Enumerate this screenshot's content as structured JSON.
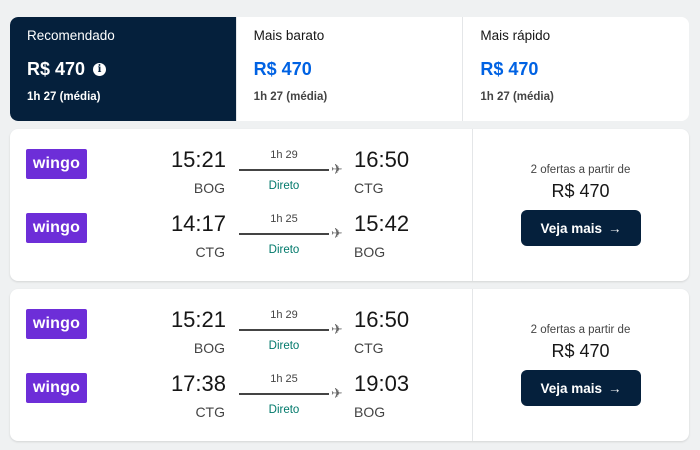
{
  "tabs": [
    {
      "label": "Recomendado",
      "price": "R$ 470",
      "duration": "1h 27 (média)",
      "info_icon": "i"
    },
    {
      "label": "Mais barato",
      "price": "R$ 470",
      "duration": "1h 27 (média)"
    },
    {
      "label": "Mais rápido",
      "price": "R$ 470",
      "duration": "1h 27 (média)"
    }
  ],
  "results": [
    {
      "legs": [
        {
          "airline": "wingo",
          "dep_time": "15:21",
          "dep_code": "BOG",
          "duration": "1h 29",
          "stops": "Direto",
          "arr_time": "16:50",
          "arr_code": "CTG"
        },
        {
          "airline": "wingo",
          "dep_time": "14:17",
          "dep_code": "CTG",
          "duration": "1h 25",
          "stops": "Direto",
          "arr_time": "15:42",
          "arr_code": "BOG"
        }
      ],
      "offers": "2 ofertas a partir de",
      "price": "R$ 470",
      "cta": "Veja mais",
      "cta_arrow": "→"
    },
    {
      "legs": [
        {
          "airline": "wingo",
          "dep_time": "15:21",
          "dep_code": "BOG",
          "duration": "1h 29",
          "stops": "Direto",
          "arr_time": "16:50",
          "arr_code": "CTG"
        },
        {
          "airline": "wingo",
          "dep_time": "17:38",
          "dep_code": "CTG",
          "duration": "1h 25",
          "stops": "Direto",
          "arr_time": "19:03",
          "arr_code": "BOG"
        }
      ],
      "offers": "2 ofertas a partir de",
      "price": "R$ 470",
      "cta": "Veja mais",
      "cta_arrow": "→"
    }
  ],
  "plane_glyph": "✈",
  "colors": {
    "navy": "#05203c",
    "blue_price": "#0062e3",
    "wingo_purple": "#6d2ed8",
    "direct_green": "#00796b"
  }
}
